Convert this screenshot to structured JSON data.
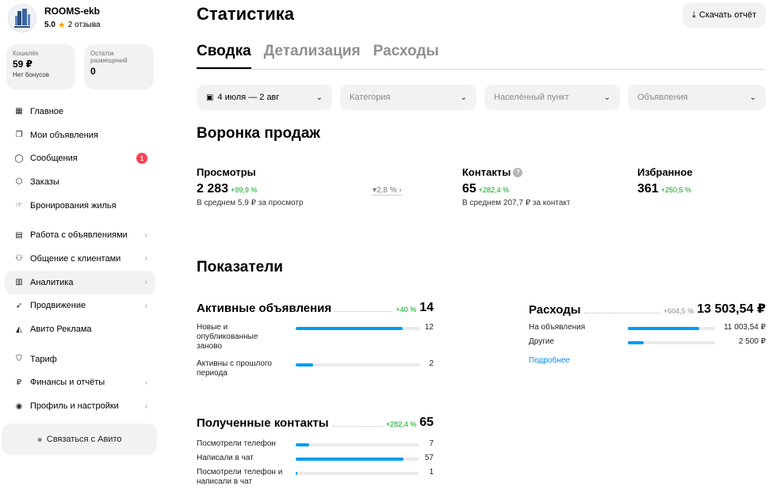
{
  "profile": {
    "name": "ROOMS-ekb",
    "rating": "5.0",
    "reviews": "2 отзыва"
  },
  "cards": {
    "wallet": {
      "label": "Кошелёк",
      "value": "59 ₽",
      "sub": "Нет бонусов"
    },
    "placements": {
      "label": "Остаток размещений",
      "value": "0"
    }
  },
  "nav": {
    "main": "Главное",
    "ads": "Мои объявления",
    "messages": "Сообщения",
    "messages_badge": "1",
    "orders": "Заказы",
    "bookings": "Бронирования жилья",
    "ads_work": "Работа с объявлениями",
    "clients": "Общение с клиентами",
    "analytics": "Аналитика",
    "promotion": "Продвижение",
    "avito_ads": "Авито Реклама",
    "tariff": "Тариф",
    "finance": "Финансы и отчёты",
    "profile_settings": "Профиль и настройки"
  },
  "contact_button": "Связаться с Авито",
  "header": {
    "title": "Статистика",
    "download": "Скачать отчёт"
  },
  "tabs": [
    "Сводка",
    "Детализация",
    "Расходы"
  ],
  "filters": {
    "date": "4 июля — 2 авг",
    "category": "Категория",
    "city": "Населённый пункт",
    "listings": "Объявления"
  },
  "funnel": {
    "title": "Воронка продаж",
    "views": {
      "label": "Просмотры",
      "value": "2 283",
      "delta": "+99,9 %",
      "avg": "В среднем 5,9 ₽ за просмотр"
    },
    "conversion": "2,8 %",
    "contacts": {
      "label": "Контакты",
      "value": "65",
      "delta": "+282,4 %",
      "avg": "В среднем 207,7 ₽ за контакт"
    },
    "favorites": {
      "label": "Избранное",
      "value": "361",
      "delta": "+250,5 %"
    }
  },
  "indicators": {
    "title": "Показатели",
    "active": {
      "label": "Активные объявления",
      "delta": "+40 %",
      "total": "14",
      "rows": [
        {
          "label": "Новые и опубликованные заново",
          "value": "12",
          "fraction": 0.857
        },
        {
          "label": "Активны с прошлого периода",
          "value": "2",
          "fraction": 0.143
        }
      ]
    },
    "expenses": {
      "label": "Расходы",
      "delta": "+604,5 %",
      "total": "13 503,54 ₽",
      "rows": [
        {
          "label": "На объявления",
          "value": "11 003,54 ₽",
          "fraction": 0.815
        },
        {
          "label": "Другие",
          "value": "2 500 ₽",
          "fraction": 0.185
        }
      ],
      "more": "Подробнее"
    },
    "contacts": {
      "label": "Полученные контакты",
      "delta": "+282,4 %",
      "total": "65",
      "rows": [
        {
          "label": "Посмотрели телефон",
          "value": "7",
          "fraction": 0.108
        },
        {
          "label": "Написали в чат",
          "value": "57",
          "fraction": 0.877
        },
        {
          "label": "Посмотрели телефон и написали в чат",
          "value": "1",
          "fraction": 0.015
        }
      ]
    }
  }
}
